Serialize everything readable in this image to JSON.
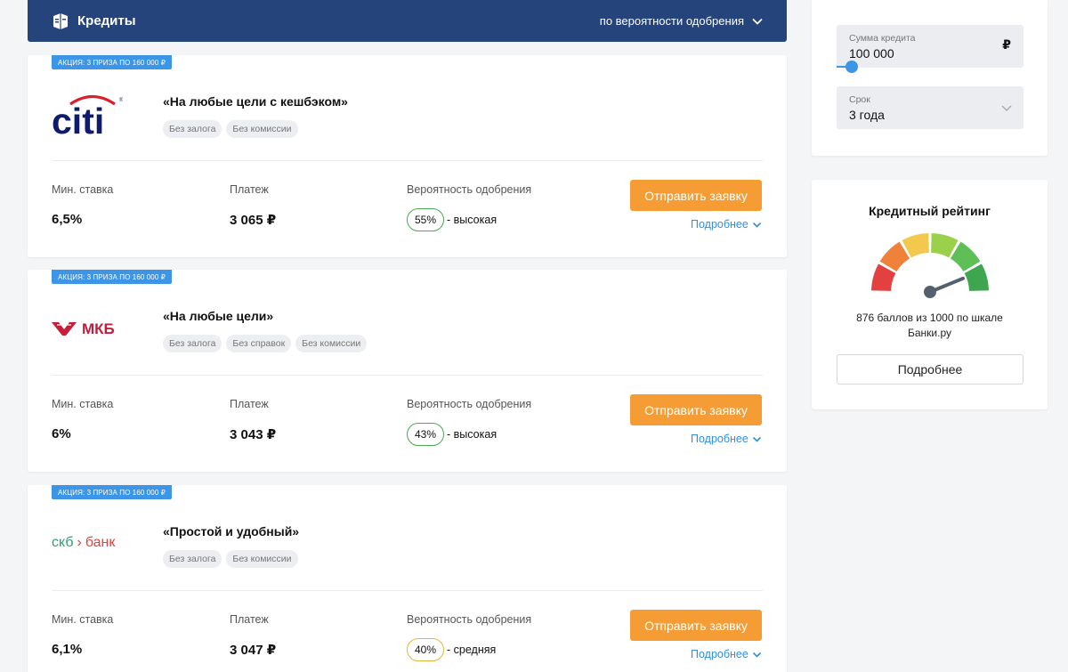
{
  "header": {
    "title": "Кредиты",
    "sort_label": "по вероятности одобрения"
  },
  "columns": {
    "rate": "Мин. ставка",
    "payment": "Платеж",
    "probability": "Вероятность одобрения"
  },
  "offers": [
    {
      "promo": "Акция: 3 приза по 160 000 ₽",
      "bank": "citi",
      "name": "«На любые цели с кешбэком»",
      "tags": [
        "Без залога",
        "Без комиссии"
      ],
      "rate": "6,5%",
      "payment": "3 065 ₽",
      "probability": "55%",
      "probability_level": "- высокая",
      "apply_label": "Отправить заявку",
      "more_label": "Подробнее"
    },
    {
      "promo": "Акция: 3 приза по 160 000 ₽",
      "bank": "МКБ",
      "name": "«На любые цели»",
      "tags": [
        "Без залога",
        "Без справок",
        "Без комиссии"
      ],
      "rate": "6%",
      "payment": "3 043 ₽",
      "probability": "43%",
      "probability_level": "- высокая",
      "apply_label": "Отправить заявку",
      "more_label": "Подробнее"
    },
    {
      "promo": "Акция: 3 приза по 160 000 ₽",
      "bank_prefix": "скб",
      "bank_suffix": "банк",
      "name": "«Простой и удобный»",
      "tags": [
        "Без залога",
        "Без комиссии"
      ],
      "rate": "6,1%",
      "payment": "3 047 ₽",
      "probability": "40%",
      "probability_level": "- средняя",
      "apply_label": "Отправить заявку",
      "more_label": "Подробнее"
    }
  ],
  "calculator": {
    "amount_label": "Сумма кредита",
    "amount_value": "100 000",
    "currency": "₽",
    "term_label": "Срок",
    "term_value": "3 года"
  },
  "rating": {
    "title": "Кредитный рейтинг",
    "score_text": "876 баллов из 1000 по шкале Банки.ру",
    "score": 876,
    "max": 1000,
    "button_label": "Подробнее"
  },
  "colors": {
    "header_bg": "#25447c",
    "accent_blue": "#3d95e8",
    "apply_orange": "#f59c34",
    "citi_blue": "#0f1c6c",
    "citi_red": "#db1e2b",
    "mkb_red": "#c41e3a",
    "skb_green": "#2e9f70",
    "skb_red": "#e0443c"
  }
}
